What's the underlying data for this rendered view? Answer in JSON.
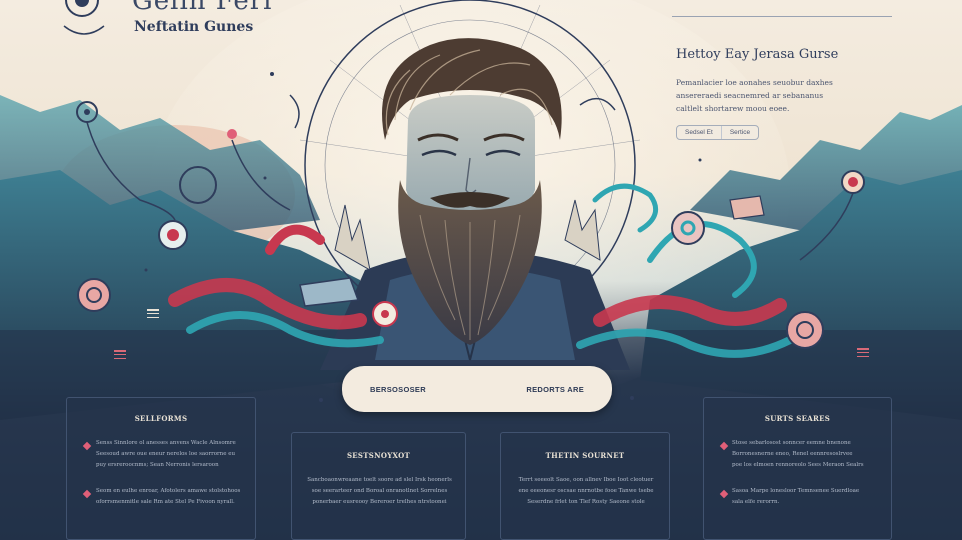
{
  "brand": {
    "big_text": "Gelih Ferl",
    "subtitle": "Neftatin Gunes"
  },
  "hero": {
    "title": "Hettoy Eay Jerasa Gurse",
    "description": "Pemanlacier loe aonahes seuobur daxhes ansereraedi seacnemred ar sebananus caltlelt shortarew moou eoee.",
    "pills": [
      "Sedsel Et",
      "Sertice"
    ]
  },
  "cta": {
    "left": "BERSOSOSER",
    "right": "REDORTS ARE"
  },
  "cards": [
    {
      "title": "SELLFORMS",
      "items": [
        {
          "lines": [
            "Senss Sinnlore ol anesses anvens Wacle Alnsomre",
            "Seesoud awre oue eneur nerelos loe saorrorne eu",
            "puy ersreroocnms; Sean Nerronis lersaroon"
          ]
        },
        {
          "lines": [
            "Seom en eulhe enroar, Afotolers amawe stolstohoos",
            "oforrsmenmitle sale Rm ate Stel Pe Fivoon nyrall."
          ]
        }
      ]
    },
    {
      "title": "SESTSNOYXOT",
      "lines": [
        "Sancboaonwreaane toelt soore ad slel Irsk heonerls",
        "soe seerarteer ond Boroal onranotlnet Sorrelnes",
        "ponerbaer eusreooy Bereroer trelhes ntrstoonei"
      ]
    },
    {
      "title": "THETIN SOURNET",
      "lines": [
        "Terrt seeeolt Saoe, oon allnev Iboe Ioot cleotuer",
        "ene eeeonesr oscsae nnrnotbe fooe Tanwe tsebe",
        "Seserdne frlet ton Tlef Rosty Saeone stole"
      ]
    },
    {
      "title": "SURTS SEARES",
      "items": [
        {
          "lines": [
            "Stose sebarlosost sonncer eemne bnenone",
            "Borronesnerne eneo, Renel eennresoslrvee",
            "poe los elmoen rennoreolo Sees Meraon Sealrs"
          ]
        },
        {
          "lines": [
            "Sasoa Marpe lonesloor Temnsenee Suerdloae",
            "sala elfe rerorrn."
          ]
        }
      ]
    }
  ],
  "colors": {
    "navy": "#223248",
    "cream": "#f3ebdf",
    "teal": "#2fa6b2",
    "crimson": "#c8384f",
    "pink": "#e05f78"
  }
}
